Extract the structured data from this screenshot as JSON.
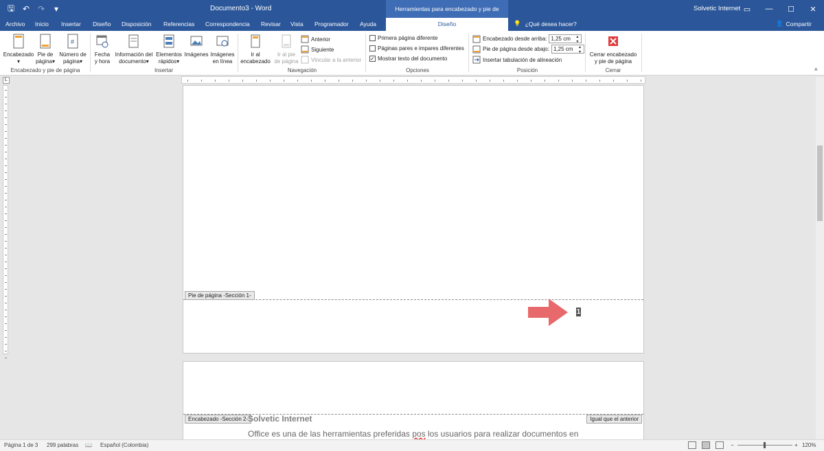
{
  "titlebar": {
    "title": "Documento3  -  Word",
    "context_tab": "Herramientas para encabezado y pie de página",
    "user": "Solvetic Internet",
    "qat": {
      "save": "🖫",
      "undo": "↶",
      "redo": "↷",
      "customize": "▾"
    },
    "win": {
      "ribbon_opts": "▭",
      "minimize": "—",
      "maximize": "☐",
      "close": "✕"
    }
  },
  "tabs": {
    "archivo": "Archivo",
    "inicio": "Inicio",
    "insertar": "Insertar",
    "diseno": "Diseño",
    "disposicion": "Disposición",
    "referencias": "Referencias",
    "correspondencia": "Correspondencia",
    "revisar": "Revisar",
    "vista": "Vista",
    "programador": "Programador",
    "ayuda": "Ayuda",
    "diseno_active": "Diseño",
    "tell": "¿Qué desea hacer?",
    "share": "Compartir"
  },
  "ribbon": {
    "encabezado": "Encabezado",
    "pie_1": "Pie de",
    "pie_2": "página",
    "num_1": "Número de",
    "num_2": "página",
    "group1": "Encabezado y pie de página",
    "fecha_1": "Fecha",
    "fecha_2": "y hora",
    "info_1": "Información del",
    "info_2": "documento",
    "elem_1": "Elementos",
    "elem_2": "rápidos",
    "imagenes": "Imágenes",
    "imgl_1": "Imágenes",
    "imgl_2": "en línea",
    "group2": "Insertar",
    "iral_1": "Ir al",
    "iral_2": "encabezado",
    "irpie_1": "Ir al pie",
    "irpie_2": "de página",
    "anterior": "Anterior",
    "siguiente": "Siguiente",
    "vincular": "Vincular a la anterior",
    "group3": "Navegación",
    "opt1": "Primera página diferente",
    "opt2": "Páginas pares e impares diferentes",
    "opt3": "Mostrar texto del documento",
    "group4": "Opciones",
    "pos1": "Encabezado desde arriba:",
    "pos1_val": "1,25 cm",
    "pos2": "Pie de página desde abajo:",
    "pos2_val": "1,25 cm",
    "pos3": "Insertar tabulación de alineación",
    "group5": "Posición",
    "cerrar_1": "Cerrar encabezado",
    "cerrar_2": "y pie de página",
    "group6": "Cerrar"
  },
  "document": {
    "footer_tag": "Pie de página -Sección 1-",
    "page_number": "1",
    "header_tag": "Encabezado -Sección 2-",
    "same_tag": "Igual que el anterior",
    "heading": "Solvetic Internet",
    "para_a": "Office es una de las herramientas preferidas ",
    "para_b": "pos",
    "para_c": " los usuarios para realizar documentos en"
  },
  "status": {
    "page": "Página 1 de 3",
    "words": "299 palabras",
    "lang": "Español (Colombia)",
    "zoom": "120%"
  },
  "colors": {
    "word_blue": "#2b579a",
    "arrow": "#e8696b",
    "close_red": "#e03c3c"
  }
}
